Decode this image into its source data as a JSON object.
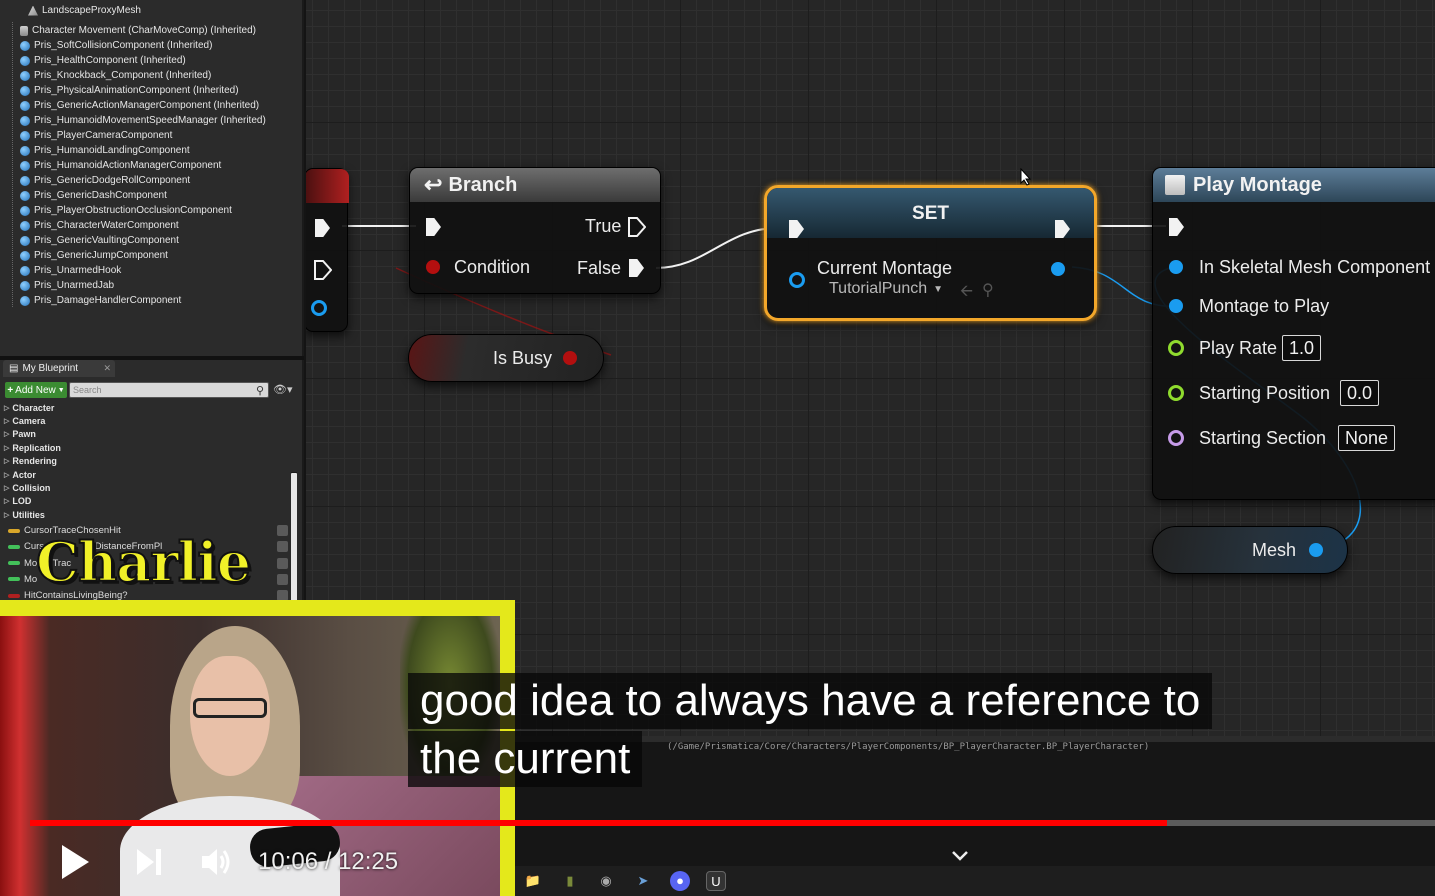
{
  "components": {
    "items": [
      {
        "label": "LandscapeProxyMesh",
        "icon": "mesh-icon"
      },
      {
        "label": "Character Movement (CharMoveComp) (Inherited)",
        "icon": "character-icon"
      },
      {
        "label": "Pris_SoftCollisionComponent (Inherited)",
        "icon": "component-icon"
      },
      {
        "label": "Pris_HealthComponent (Inherited)",
        "icon": "component-icon"
      },
      {
        "label": "Pris_Knockback_Component (Inherited)",
        "icon": "component-icon"
      },
      {
        "label": "Pris_PhysicalAnimationComponent (Inherited)",
        "icon": "component-icon"
      },
      {
        "label": "Pris_GenericActionManagerComponent (Inherited)",
        "icon": "component-icon"
      },
      {
        "label": "Pris_HumanoidMovementSpeedManager (Inherited)",
        "icon": "component-icon"
      },
      {
        "label": "Pris_PlayerCameraComponent",
        "icon": "component-icon"
      },
      {
        "label": "Pris_HumanoidLandingComponent",
        "icon": "component-icon"
      },
      {
        "label": "Pris_HumanoidActionManagerComponent",
        "icon": "component-icon"
      },
      {
        "label": "Pris_GenericDodgeRollComponent",
        "icon": "component-icon"
      },
      {
        "label": "Pris_GenericDashComponent",
        "icon": "component-icon"
      },
      {
        "label": "Pris_PlayerObstructionOcclusionComponent",
        "icon": "component-icon"
      },
      {
        "label": "Pris_CharacterWaterComponent",
        "icon": "component-icon"
      },
      {
        "label": "Pris_GenericVaultingComponent",
        "icon": "component-icon"
      },
      {
        "label": "Pris_GenericJumpComponent",
        "icon": "component-icon"
      },
      {
        "label": "Pris_UnarmedHook",
        "icon": "component-icon"
      },
      {
        "label": "Pris_UnarmedJab",
        "icon": "component-icon"
      },
      {
        "label": "Pris_DamageHandlerComponent",
        "icon": "component-icon"
      }
    ]
  },
  "my_blueprint": {
    "tab_label": "My Blueprint",
    "add_new_label": "Add New",
    "search_placeholder": "Search",
    "categories": [
      "Character",
      "Camera",
      "Pawn",
      "Replication",
      "Rendering",
      "Actor",
      "Collision",
      "LOD",
      "Utilities"
    ],
    "variables": [
      {
        "label": "CursorTraceChosenHit",
        "color": "#d9a72a"
      },
      {
        "label": "Curs",
        "color": "#43c15a"
      },
      {
        "label": "Mo",
        "color": "#43c15a"
      },
      {
        "label": "Mo",
        "color": "#43c15a"
      },
      {
        "label": "HitContainsLivingBeing?",
        "color": "#b02020"
      }
    ],
    "variable_fragments": {
      "distance": "tDistanceFromPl",
      "trace": "eTrac"
    }
  },
  "graph": {
    "branch": {
      "title": "Branch",
      "true_label": "True",
      "condition_label": "Condition",
      "false_label": "False"
    },
    "is_busy": {
      "label": "Is Busy"
    },
    "set": {
      "title": "SET",
      "var_label": "Current Montage",
      "var_value": "TutorialPunch"
    },
    "play_montage": {
      "title": "Play Montage",
      "pins": [
        {
          "label": "In Skeletal Mesh Component",
          "type": "object"
        },
        {
          "label": "Montage to Play",
          "type": "object"
        },
        {
          "label": "Play Rate",
          "type": "float",
          "value": "1.0"
        },
        {
          "label": "Starting Position",
          "type": "float",
          "value": "0.0"
        },
        {
          "label": "Starting Section",
          "type": "name",
          "value": "None"
        }
      ]
    },
    "mesh": {
      "label": "Mesh"
    },
    "colors": {
      "exec": "#f2f2f2",
      "bool": "#b30f0f",
      "object": "#1a9cf0",
      "float": "#8fdb2e",
      "name": "#c69be8",
      "selected": "#f3a72a"
    }
  },
  "status": {
    "asset_path": "(/Game/Prismatica/Core/Characters/PlayerComponents/BP_PlayerCharacter.BP_PlayerCharacter)"
  },
  "overlay": {
    "streamer_name": "Charlie"
  },
  "captions": {
    "line1": "good idea to always have a reference to",
    "line2": "the current"
  },
  "player": {
    "time": "10:06 / 12:25",
    "current": "10:06",
    "duration": "12:25",
    "progress": 0.8094,
    "accent": "#ff0000"
  },
  "taskbar": {
    "icons": [
      "folder-icon",
      "chart-icon",
      "steam-icon",
      "steam-alt-icon",
      "discord-icon",
      "unreal-icon"
    ]
  }
}
